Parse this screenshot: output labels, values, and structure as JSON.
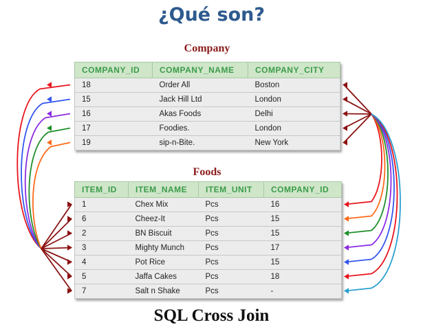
{
  "slide": {
    "title": "¿Qué son?",
    "footer": "SQL Cross Join"
  },
  "company": {
    "caption": "Company",
    "columns": [
      "COMPANY_ID",
      "COMPANY_NAME",
      "COMPANY_CITY"
    ],
    "rows": [
      [
        "18",
        "Order All",
        "Boston"
      ],
      [
        "15",
        "Jack Hill Ltd",
        "London"
      ],
      [
        "16",
        "Akas Foods",
        "Delhi"
      ],
      [
        "17",
        "Foodies.",
        "London"
      ],
      [
        "19",
        "sip-n-Bite.",
        "New York"
      ]
    ]
  },
  "foods": {
    "caption": "Foods",
    "columns": [
      "ITEM_ID",
      "ITEM_NAME",
      "ITEM_UNIT",
      "COMPANY_ID"
    ],
    "rows": [
      [
        "1",
        "Chex Mix",
        "Pcs",
        "16"
      ],
      [
        "6",
        "Cheez-It",
        "Pcs",
        "15"
      ],
      [
        "2",
        "BN Biscuit",
        "Pcs",
        "15"
      ],
      [
        "3",
        "Mighty Munch",
        "Pcs",
        "17"
      ],
      [
        "4",
        "Pot Rice",
        "Pcs",
        "15"
      ],
      [
        "5",
        "Jaffa Cakes",
        "Pcs",
        "18"
      ],
      [
        "7",
        "Salt n Shake",
        "Pcs",
        "-"
      ]
    ]
  },
  "arrow_colors": {
    "company_left": [
      "#e8141c",
      "#3355ee",
      "#8a2be2",
      "#1f8f2a",
      "#ff6a1a"
    ],
    "foods_right": [
      "#7a0f0f",
      "#e8141c",
      "#ff6a1a",
      "#1f8f2a",
      "#8a2be2",
      "#3355ee",
      "#e8141c",
      "#2a9fd0"
    ],
    "dark": "#8b1212"
  }
}
